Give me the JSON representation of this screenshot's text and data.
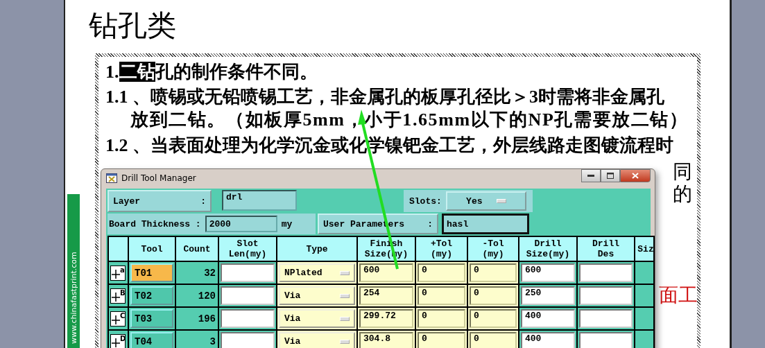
{
  "slide": {
    "title": "钻孔类",
    "side_banner": "www.chinafastprint.com",
    "lines": [
      {
        "kind": "lead",
        "number": "1.",
        "segments": [
          {
            "text": "二钻",
            "highlighted": true
          },
          {
            "text": "孔的制作条件不同。",
            "highlighted": false
          }
        ]
      },
      {
        "kind": "lead",
        "number": "1.1 、",
        "segments": [
          {
            "text": "喷锡或无铅喷锡工艺，非金属孔的板厚孔径比＞3时需将非金属孔",
            "highlighted": false
          }
        ]
      },
      {
        "kind": "continuation",
        "segments": [
          {
            "text": "放到二钻。（如板厚5mm，小于1.65mm以下的NP孔需要放二钻）",
            "highlighted": false
          }
        ]
      },
      {
        "kind": "lead",
        "number": "1.2 、",
        "segments": [
          {
            "text": "当表面处理为化学沉金或化学镍钯金工艺，外层线路走图镀流程时",
            "highlighted": false
          }
        ]
      }
    ],
    "fragments": [
      {
        "text": "同",
        "color": "#000000"
      },
      {
        "text": "的",
        "color": "#000000"
      },
      {
        "text": "面工",
        "color": "#d01010"
      }
    ]
  },
  "dialog": {
    "title": "Drill Tool Manager",
    "layer": {
      "label": "Layer",
      "suffix": ":",
      "value": "drl"
    },
    "slots": {
      "label": "Slots:",
      "value": "Yes"
    },
    "board_thickness": {
      "label": "Board Thickness :",
      "value": "2000",
      "unit": "my"
    },
    "user_parameters": {
      "label": "User Parameters",
      "suffix": ":",
      "value": "hasl"
    },
    "table": {
      "columns": [
        [
          "Tool"
        ],
        [
          "Count"
        ],
        [
          "Slot",
          "Len(my)"
        ],
        [
          "Type"
        ],
        [
          "Finish",
          "Size(my)"
        ],
        [
          "+Tol",
          "(my)"
        ],
        [
          "-Tol",
          "(my)"
        ],
        [
          "Drill",
          "Size(my)"
        ],
        [
          "Drill",
          "Des"
        ],
        [
          "Siz"
        ]
      ],
      "rows": [
        {
          "marker": "a",
          "tool": "T01",
          "selected": true,
          "count": "32",
          "type": "NPlated",
          "finish": "600",
          "plus_tol": "0",
          "minus_tol": "0",
          "drill_size": "600"
        },
        {
          "marker": "B",
          "tool": "T02",
          "selected": false,
          "count": "120",
          "type": "Via",
          "finish": "254",
          "plus_tol": "0",
          "minus_tol": "0",
          "drill_size": "250"
        },
        {
          "marker": "C",
          "tool": "T03",
          "selected": false,
          "count": "196",
          "type": "Via",
          "finish": "299.72",
          "plus_tol": "0",
          "minus_tol": "0",
          "drill_size": "400"
        },
        {
          "marker": "D",
          "tool": "T04",
          "selected": false,
          "count": "3",
          "type": "Via",
          "finish": "304.8",
          "plus_tol": "0",
          "minus_tol": "0",
          "drill_size": "400"
        }
      ]
    }
  }
}
